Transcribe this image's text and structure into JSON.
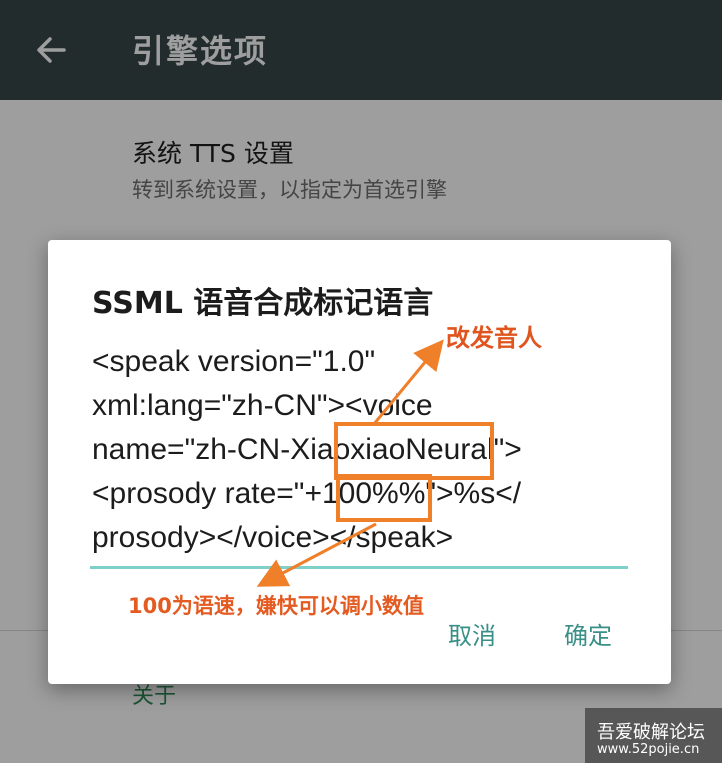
{
  "appbar": {
    "title": "引擎选项",
    "back_icon": "arrow-left-icon"
  },
  "preferences": [
    {
      "title": "系统 TTS 设置",
      "summary": "转到系统设置，以指定为首选引擎"
    }
  ],
  "about_label": "关于",
  "dialog": {
    "title": "SSML 语音合成标记语言",
    "ssml_lines": [
      "<speak version=\"1.0\"",
      "xml:lang=\"zh-CN\"><voice",
      "name=\"zh-CN-XiaoxiaoNeural\">",
      "<prosody rate=\"+100%%\">%s</",
      "prosody></voice></speak>"
    ],
    "cancel_label": "取消",
    "ok_label": "确定"
  },
  "annotations": {
    "voice_note": "改发音人",
    "rate_note": "100为语速，嫌快可以调小数值",
    "color": "#ef7f28"
  },
  "watermark": {
    "title": "吾爱破解论坛",
    "url": "www.52pojie.cn"
  },
  "colors": {
    "appbar": "#37474a",
    "accent": "#3a8f86",
    "input_underline": "#7fd0c8"
  }
}
